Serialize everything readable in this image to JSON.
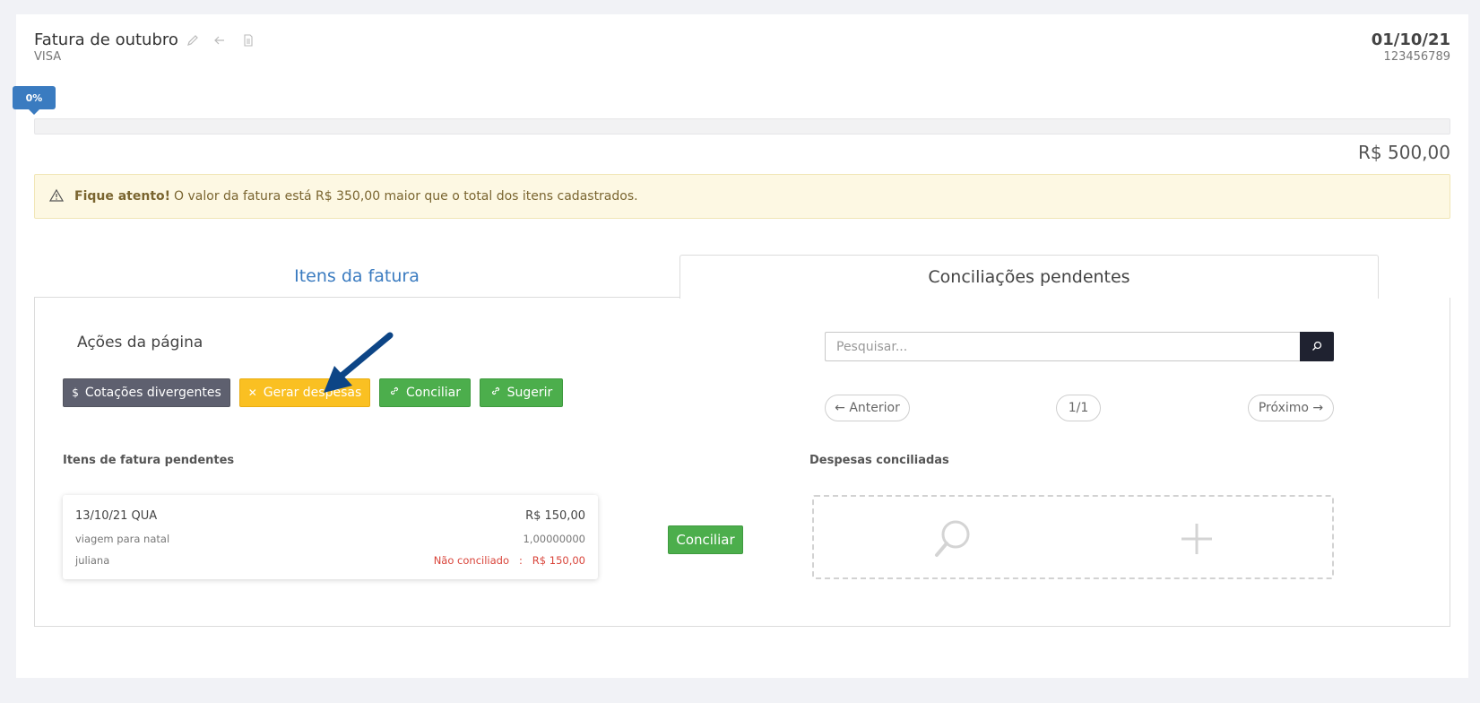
{
  "invoice": {
    "title": "Fatura de outubro",
    "subtitle": "VISA",
    "date": "01/10/21",
    "number": "123456789",
    "total": "R$ 500,00"
  },
  "progress": {
    "label": "0%",
    "value": 0
  },
  "alert": {
    "strong": "Fique atento!",
    "message": "O valor da fatura está R$ 350,00 maior que o total dos itens cadastrados."
  },
  "tabs": {
    "items": "Itens da fatura",
    "pending": "Conciliações pendentes"
  },
  "actions": {
    "title": "Ações da página",
    "divergent": "Cotações divergentes",
    "generate": "Gerar despesas",
    "reconcile": "Conciliar",
    "suggest": "Sugerir"
  },
  "search": {
    "placeholder": "Pesquisar..."
  },
  "pagination": {
    "prev": "← Anterior",
    "page": "1/1",
    "next": "Próximo →"
  },
  "sections": {
    "pending_items": "Itens de fatura pendentes",
    "reconciled_expenses": "Despesas conciliadas"
  },
  "pending_item": {
    "date": "13/10/21 QUA",
    "amount": "R$ 150,00",
    "description": "viagem para natal",
    "rate": "1,00000000",
    "user": "juliana",
    "status": "Não conciliado",
    "separator": ":",
    "status_amount": "R$ 150,00"
  },
  "row_action": {
    "reconcile": "Conciliar"
  },
  "colors": {
    "primary": "#3a7bc0",
    "warning": "#fac022",
    "success": "#4cae4c",
    "dark": "#5e606f",
    "danger": "#d9443a"
  },
  "icons": {
    "edit": "pencil-icon",
    "back": "arrow-left-icon",
    "document": "document-icon",
    "warning": "warning-triangle-icon",
    "dollar": "dollar-icon",
    "tools": "cross-tools-icon",
    "link": "link-icon",
    "search": "search-icon",
    "plus": "plus-icon"
  }
}
